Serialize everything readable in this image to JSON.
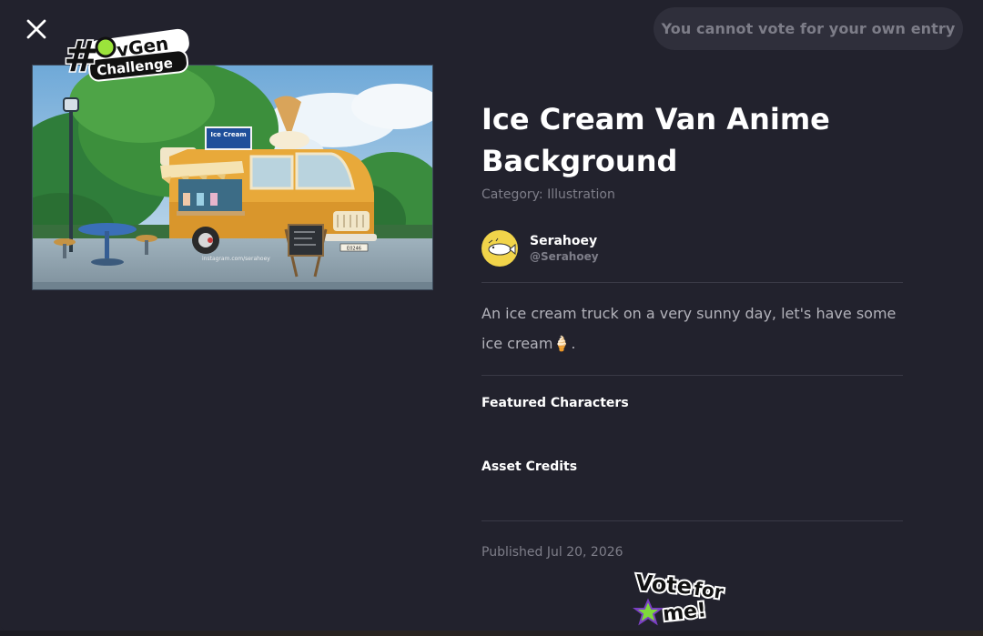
{
  "header": {
    "vote_button_label": "You cannot vote for your own entry"
  },
  "badges": {
    "challenge_badge_text": "#lovGen Challenge",
    "vote_sticker_text": "Vote for me!"
  },
  "artwork": {
    "sign_text": "Ice Cream",
    "watermark": "instagram.com/serahoey",
    "license_plate": "E0246"
  },
  "entry": {
    "title": "Ice Cream Van Anime Background",
    "category": "Category: Illustration",
    "author_name": "Serahoey",
    "author_handle": "@Serahoey",
    "description": "An ice cream truck on a very sunny day, let's have some ice cream🍦.",
    "featured_characters_heading": "Featured Characters",
    "asset_credits_heading": "Asset Credits",
    "published": "Published Jul 20, 2026"
  },
  "icons": {
    "close": "close-icon",
    "avatar": "fish-avatar",
    "vote_star": "star-icon"
  },
  "colors": {
    "background": "#22222d",
    "button_background": "#2f2f3b",
    "muted_text": "#7e7e89",
    "body_text": "#b3b3bb",
    "avatar_background": "#f1d44a",
    "van_body": "#e8a93a"
  }
}
